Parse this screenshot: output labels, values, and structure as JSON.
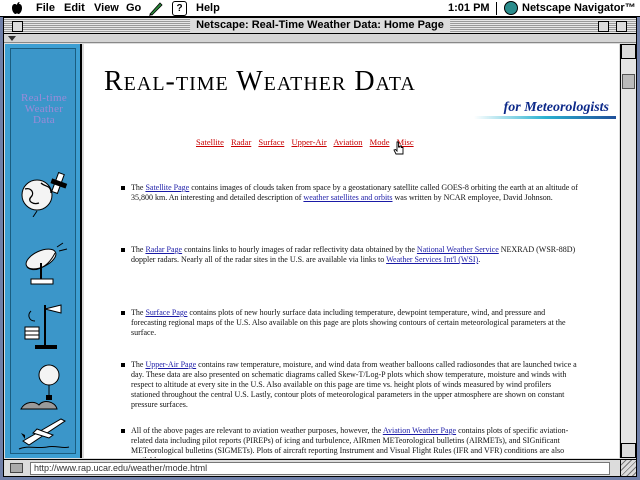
{
  "menubar": {
    "items": [
      "File",
      "Edit",
      "View",
      "Go",
      "Help"
    ],
    "clock": "1:01 PM",
    "app_name": "Netscape Navigator™"
  },
  "window": {
    "title": "Netscape: Real-Time Weather Data: Home Page"
  },
  "nav": {
    "logo_lines": [
      "Real-time",
      "Weather",
      "Data"
    ],
    "icons": [
      "globe-satellite-icon",
      "radar-dish-icon",
      "weather-station-icon",
      "weather-balloon-icon",
      "airplane-icon"
    ]
  },
  "page": {
    "heading": "Real-time Weather Data",
    "subtitle": "for Meteorologists",
    "links": [
      "Satellite",
      "Radar",
      "Surface",
      "Upper-Air",
      "Aviation",
      "Mode",
      "Misc"
    ],
    "sections": [
      {
        "before": "The ",
        "link": "Satellite Page",
        "mid": " contains images of clouds taken from space by a geostationary satellite called GOES-8 orbiting the earth at an altitude of 35,800 km. An interesting and detailed description of ",
        "link2": "weather satellites and orbits",
        "after": " was written by NCAR employee, David Johnson."
      },
      {
        "before": "The ",
        "link": "Radar Page",
        "mid": " contains links to hourly images of radar reflectivity data obtained by the ",
        "link2": "National Weather Service",
        "mid2": " NEXRAD (WSR-88D) doppler radars. Nearly all of the radar sites in the U.S. are available via links to ",
        "link3": "Weather Services Int'l (WSI)",
        "after": "."
      },
      {
        "before": "The ",
        "link": "Surface Page",
        "after": " contains plots of new hourly surface data including temperature, dewpoint temperature, wind, and pressure and forecasting regional maps of the U.S. Also available on this page are plots showing contours of certain meteorological parameters at the surface."
      },
      {
        "before": "The ",
        "link": "Upper-Air Page",
        "after": " contains raw temperature, moisture, and wind data from weather balloons called radiosondes that are launched twice a day. These data are also presented on schematic diagrams called Skew-T/Log-P plots which show temperature, moisture and winds with respect to altitude at every site in the U.S. Also available on this page are time vs. height plots of winds measured by wind profilers stationed throughout the central U.S. Lastly, contour plots of meteorological parameters in the upper atmosphere are shown on constant pressure surfaces."
      },
      {
        "before": "All of the above pages are relevant to aviation weather purposes, however, the ",
        "link": "Aviation Weather Page",
        "after": " contains plots of specific aviation-related data including pilot reports (PIREPs) of icing and turbulence, AIRmen METeorological bulletins (AIRMETs), and SIGnificant METeorological bulletins (SIGMETs). Plots of aircraft reporting Instrument and Visual Flight Rules (IFR and VFR) conditions are also available."
      }
    ]
  },
  "status": {
    "url": "http://www.rap.ucar.edu/weather/mode.html"
  }
}
